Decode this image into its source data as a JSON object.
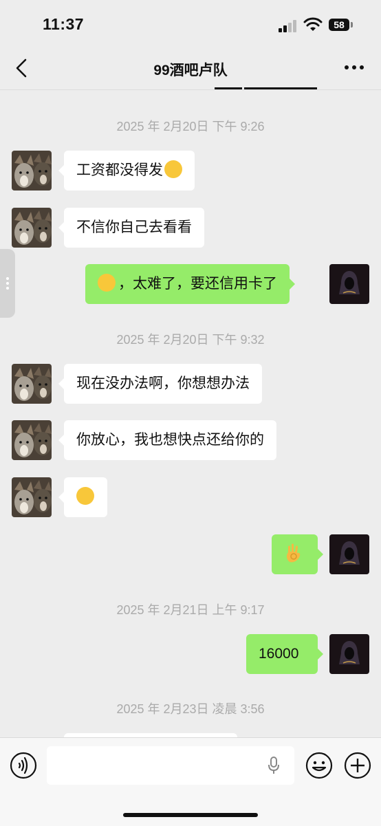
{
  "status": {
    "time": "11:37",
    "battery": "58"
  },
  "nav": {
    "title": "99酒吧卢队"
  },
  "timestamps": [
    "2025 年 2月20日 下午 9:26",
    "2025 年 2月20日 下午 9:32",
    "2025 年 2月21日 上午 9:17",
    "2025 年 2月23日 凌晨 3:56"
  ],
  "messages": [
    {
      "dir": "in",
      "text": "工资都没得发",
      "emoji": "😂"
    },
    {
      "dir": "in",
      "text": "不信你自己去看看"
    },
    {
      "dir": "out",
      "lead_emoji": "😄",
      "text": "，太难了，要还信用卡了"
    },
    {
      "dir": "in",
      "text": "现在没办法啊，你想想办法"
    },
    {
      "dir": "in",
      "text": "你放心，我也想快点还给你的"
    },
    {
      "dir": "in",
      "emoji": "😂"
    },
    {
      "dir": "out",
      "emoji": "👌"
    },
    {
      "dir": "out",
      "text": "16000"
    }
  ],
  "colors": {
    "outgoing_bubble": "#95ec69",
    "incoming_bubble": "#ffffff",
    "background": "#ededed"
  },
  "icons": [
    "back-icon",
    "more-icon",
    "voice-icon",
    "mic-icon",
    "emoji-icon",
    "plus-icon"
  ]
}
